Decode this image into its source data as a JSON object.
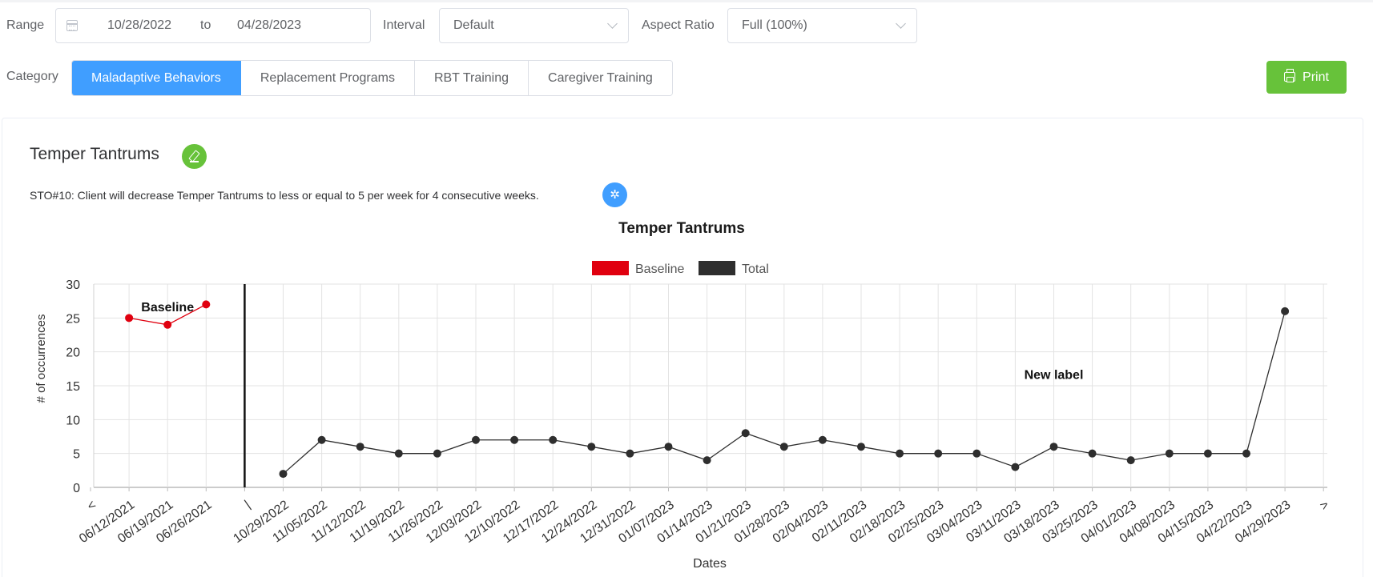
{
  "filters": {
    "range_label": "Range",
    "range_start": "10/28/2022",
    "range_sep": "to",
    "range_end": "04/28/2023",
    "interval_label": "Interval",
    "interval_value": "Default",
    "aspect_label": "Aspect Ratio",
    "aspect_value": "Full (100%)"
  },
  "category": {
    "label": "Category",
    "tabs": [
      "Maladaptive Behaviors",
      "Replacement Programs",
      "RBT Training",
      "Caregiver Training"
    ],
    "active_index": 0
  },
  "print_label": "Print",
  "goal": {
    "title": "Temper Tantrums",
    "sto": "STO#10: Client will decrease Temper Tantrums to less or equal to 5 per week for 4 consecutive weeks."
  },
  "colors": {
    "accent": "#409eff",
    "success": "#67c23a",
    "baseline": "#e0000f",
    "total": "#2e2e2e"
  },
  "icons": {
    "calendar": "calendar-icon",
    "chevron": "chevron-down-icon",
    "print": "printer-icon",
    "edit": "edit-icon",
    "wand": "magic-wand-icon"
  },
  "chart_data": {
    "type": "line",
    "title": "Temper Tantrums",
    "xlabel": "Dates",
    "ylabel": "# of occurrences",
    "ylim": [
      0,
      30
    ],
    "yticks": [
      0,
      5,
      10,
      15,
      20,
      25,
      30
    ],
    "grid": true,
    "legend_placement": "top-center",
    "categories": [
      "<",
      "06/12/2021",
      "06/19/2021",
      "06/26/2021",
      "|",
      "10/29/2022",
      "11/05/2022",
      "11/12/2022",
      "11/19/2022",
      "11/26/2022",
      "12/03/2022",
      "12/10/2022",
      "12/17/2022",
      "12/24/2022",
      "12/31/2022",
      "01/07/2023",
      "01/14/2023",
      "01/21/2023",
      "01/28/2023",
      "02/04/2023",
      "02/11/2023",
      "02/18/2023",
      "02/25/2023",
      "03/04/2023",
      "03/11/2023",
      "03/18/2023",
      "03/25/2023",
      "04/01/2023",
      "04/08/2023",
      "04/15/2023",
      "04/22/2023",
      "04/29/2023",
      ">"
    ],
    "series": [
      {
        "name": "Baseline",
        "x": [
          "06/12/2021",
          "06/19/2021",
          "06/26/2021"
        ],
        "values": [
          25,
          24,
          27
        ]
      },
      {
        "name": "Total",
        "x": [
          "10/29/2022",
          "11/05/2022",
          "11/12/2022",
          "11/19/2022",
          "11/26/2022",
          "12/03/2022",
          "12/10/2022",
          "12/17/2022",
          "12/24/2022",
          "12/31/2022",
          "01/07/2023",
          "01/14/2023",
          "01/21/2023",
          "01/28/2023",
          "02/04/2023",
          "02/11/2023",
          "02/18/2023",
          "02/25/2023",
          "03/04/2023",
          "03/11/2023",
          "03/18/2023",
          "03/25/2023",
          "04/01/2023",
          "04/08/2023",
          "04/15/2023",
          "04/22/2023",
          "04/29/2023"
        ],
        "values": [
          2,
          7,
          6,
          5,
          5,
          7,
          7,
          7,
          6,
          5,
          6,
          4,
          8,
          6,
          7,
          6,
          5,
          5,
          5,
          3,
          6,
          5,
          4,
          5,
          5,
          5,
          26
        ]
      }
    ],
    "phase_line_at": "|",
    "annotations": [
      {
        "text": "Baseline",
        "x": "06/19/2021",
        "y": 26
      },
      {
        "text": "New label",
        "x": "03/18/2023",
        "y": 16
      }
    ]
  }
}
